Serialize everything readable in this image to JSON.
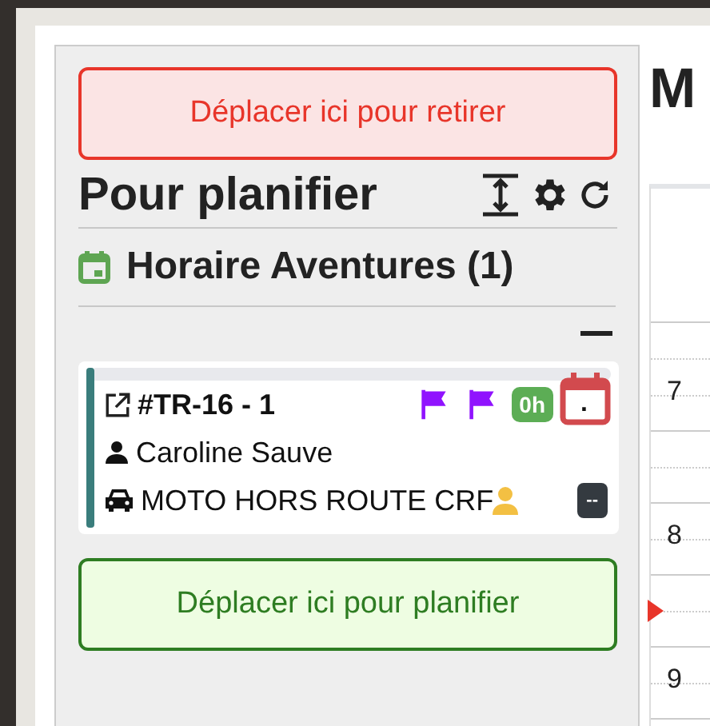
{
  "sidebar": {
    "remove_zone": "Déplacer ici pour retirer",
    "title": "Pour planifier",
    "group": {
      "title": "Horaire Aventures (1)",
      "expanded": true,
      "cards": [
        {
          "code": "#TR-16 - 1",
          "client": "Caroline Sauve",
          "vehicle": "MOTO HORS ROUTE CRF",
          "duration": "0h",
          "date_mark": ".",
          "status_badge": "--",
          "flags": [
            {
              "color": "#9013fe"
            },
            {
              "color": "#9013fe"
            }
          ]
        }
      ]
    },
    "plan_zone": "Déplacer ici pour planifier"
  },
  "main": {
    "heading": "M",
    "calendar": {
      "hours": [
        "7",
        "8",
        "9"
      ]
    }
  }
}
